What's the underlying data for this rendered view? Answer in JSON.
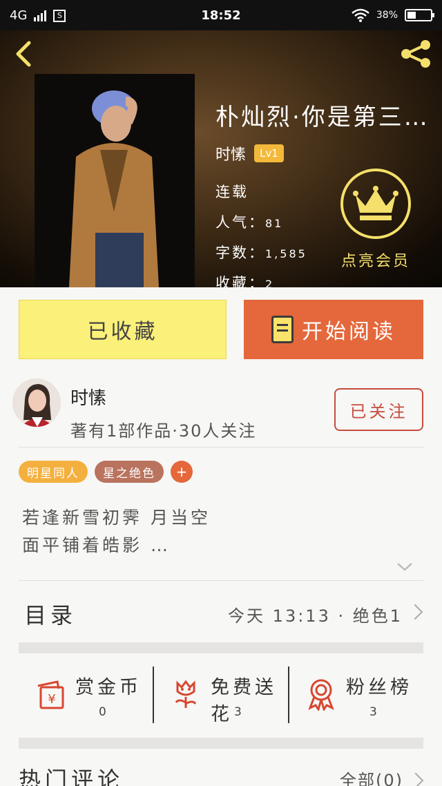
{
  "status_bar": {
    "network": "4G",
    "sim": "S",
    "time": "18:52",
    "battery": "38%"
  },
  "book": {
    "title": "朴灿烈·你是第三…",
    "author": "时愫",
    "level": "Lv1",
    "status": "连载",
    "popularity_label": "人气：",
    "popularity": "81",
    "word_count_label": "字数：",
    "word_count": "1,585",
    "favorites_label": "收藏：",
    "favorites": "2"
  },
  "vip": {
    "label": "点亮会员"
  },
  "actions": {
    "favorite_label": "已收藏",
    "read_label": "开始阅读"
  },
  "author_section": {
    "name": "时愫",
    "stats": "著有1部作品·30人关注",
    "follow_label": "已关注"
  },
  "tags": [
    {
      "label": "明星同人",
      "color": "#f4b03e"
    },
    {
      "label": "星之绝色",
      "color": "#b9735e"
    }
  ],
  "tag_add": "+",
  "description": {
    "line1": "若逢新雪初霁 月当空",
    "line2": "面平铺着皓影 …"
  },
  "toc": {
    "label": "目录",
    "latest": "今天 13:13 · 绝色1"
  },
  "interactions": [
    {
      "label": "赏金币",
      "count": "0",
      "icon": "red-envelope-icon"
    },
    {
      "label": "免费送花",
      "count": "3",
      "icon": "flower-icon"
    },
    {
      "label": "粉丝榜",
      "count": "3",
      "icon": "medal-icon"
    }
  ],
  "comments": {
    "title": "热门评论",
    "all_label": "全部(0)"
  },
  "colors": {
    "accent_orange": "#e4683c",
    "accent_yellow": "#fbf07a",
    "vip_gold": "#f4e06a",
    "follow_red": "#c64b3f"
  }
}
